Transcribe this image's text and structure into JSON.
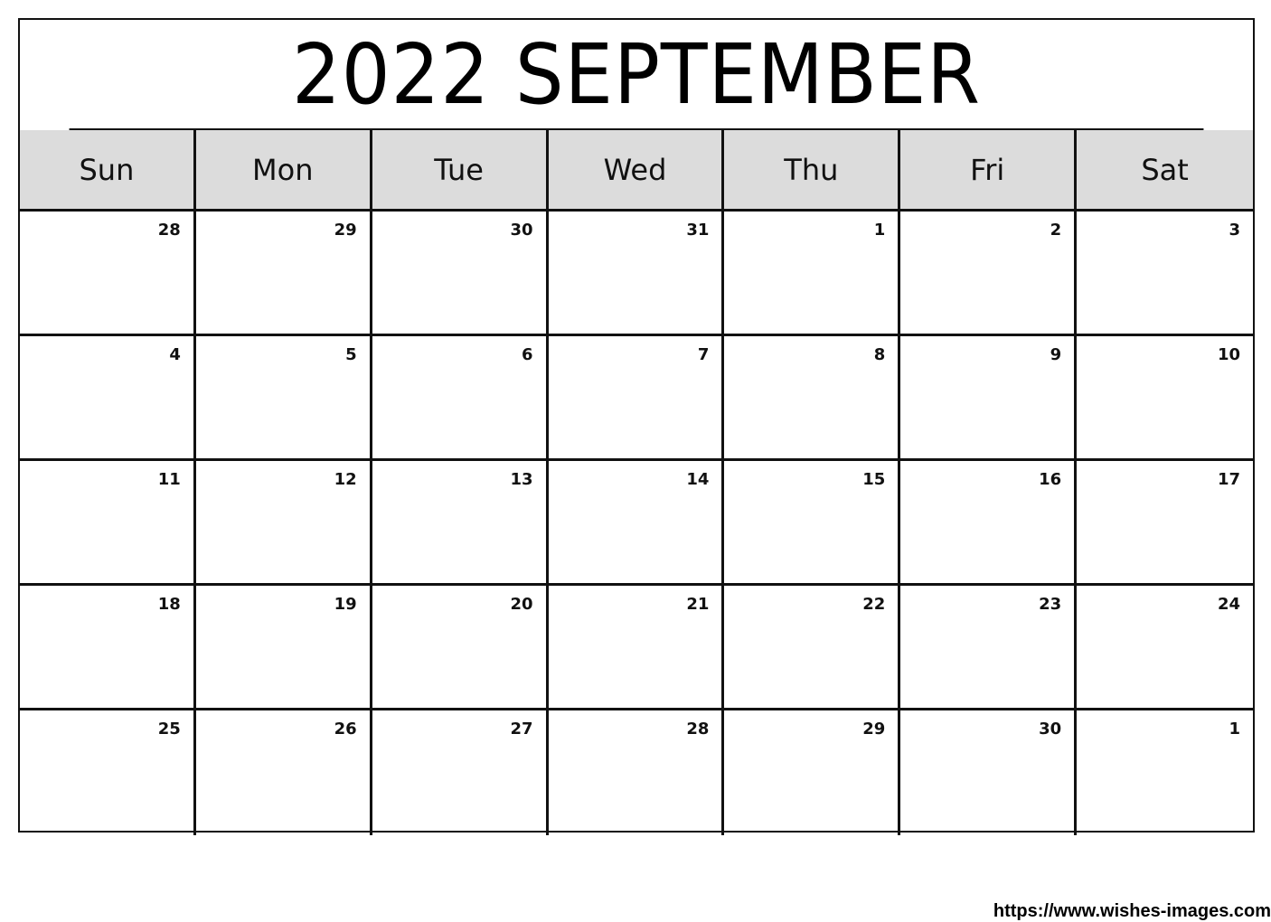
{
  "calendar": {
    "title": "2022 SEPTEMBER",
    "weekdays": [
      "Sun",
      "Mon",
      "Tue",
      "Wed",
      "Thu",
      "Fri",
      "Sat"
    ],
    "weeks": [
      [
        "28",
        "29",
        "30",
        "31",
        "1",
        "2",
        "3"
      ],
      [
        "4",
        "5",
        "6",
        "7",
        "8",
        "9",
        "10"
      ],
      [
        "11",
        "12",
        "13",
        "14",
        "15",
        "16",
        "17"
      ],
      [
        "18",
        "19",
        "20",
        "21",
        "22",
        "23",
        "24"
      ],
      [
        "25",
        "26",
        "27",
        "28",
        "29",
        "30",
        "1"
      ]
    ]
  },
  "footer": {
    "url": "https://www.wishes-images.com"
  },
  "colors": {
    "header_bg": "#dcdcdc",
    "border": "#111111"
  }
}
